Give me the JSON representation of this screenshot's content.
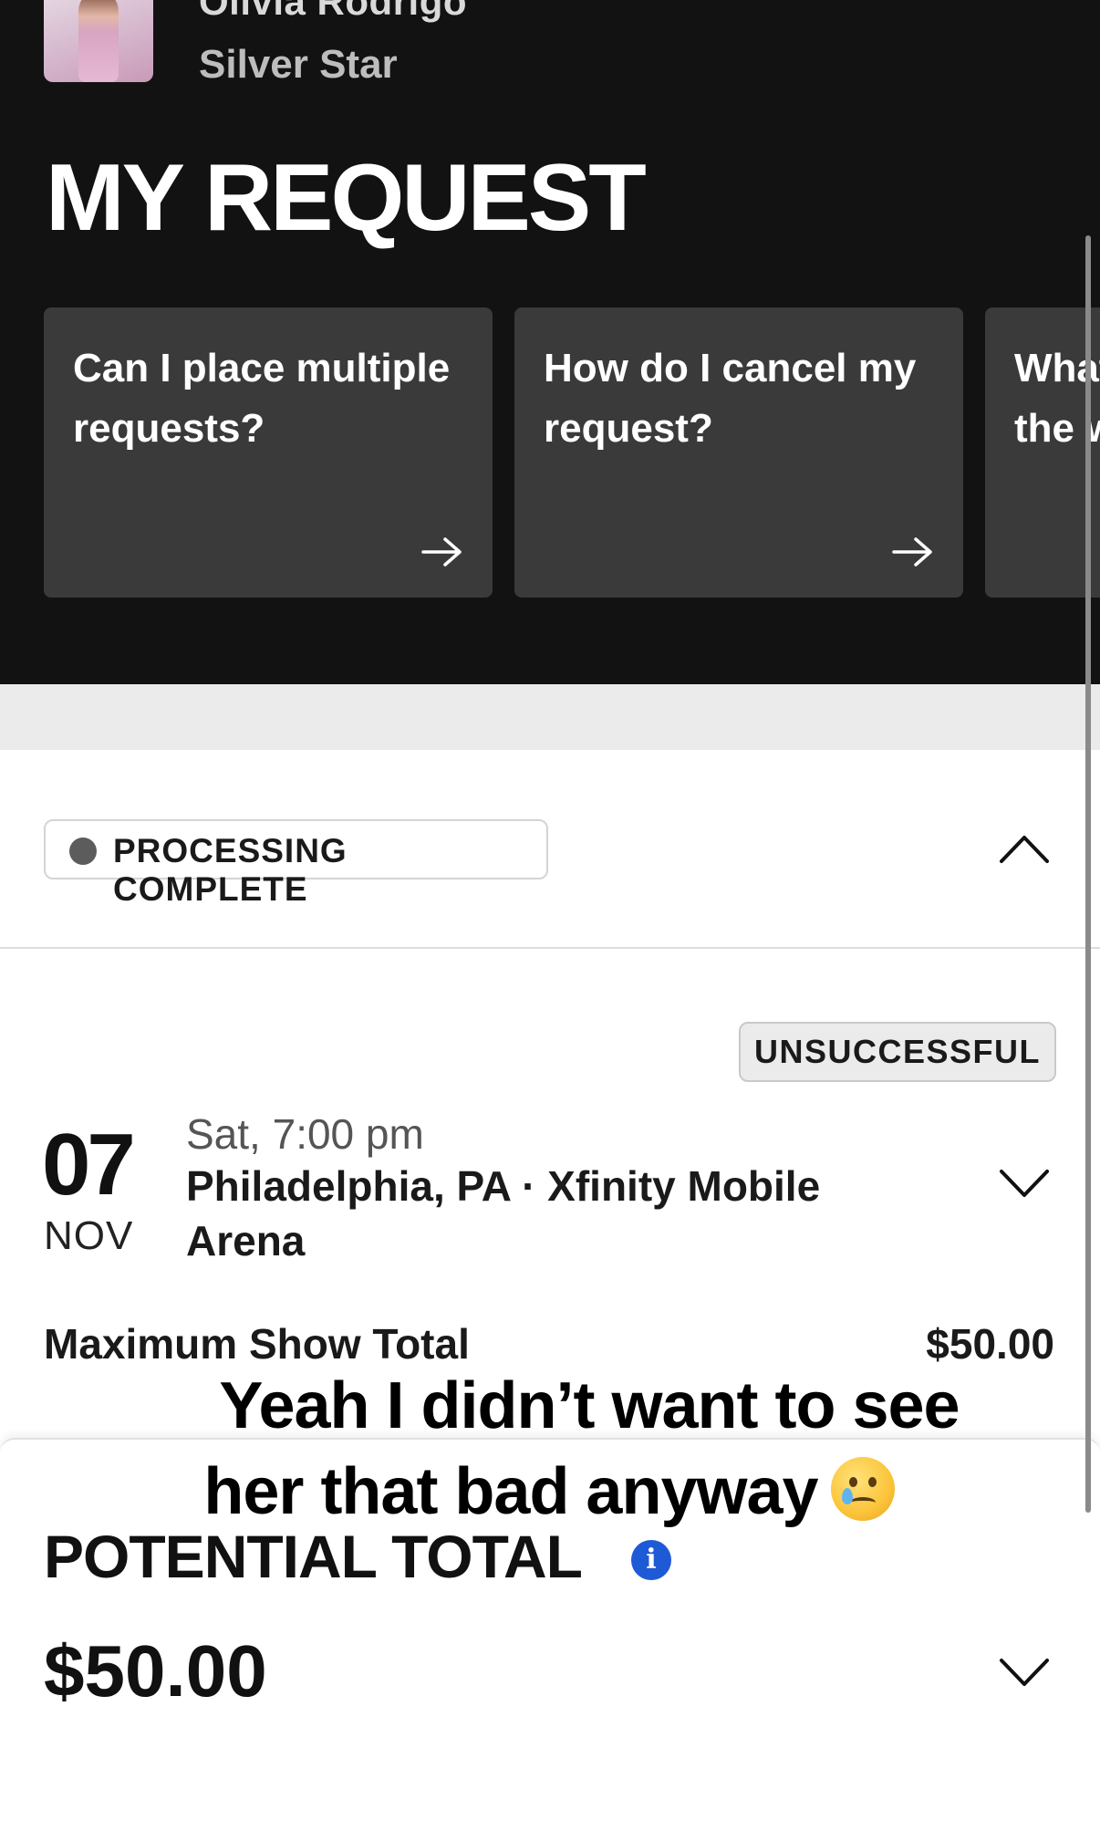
{
  "artist": {
    "name": "Olivia Rodrigo",
    "tier": "Silver Star"
  },
  "page_title": "MY REQUEST",
  "faq_cards": [
    {
      "question": "Can I place multiple requests?"
    },
    {
      "question": "How do I cancel my request?"
    },
    {
      "question": "What happens once the window"
    }
  ],
  "request": {
    "status": "PROCESSING COMPLETE",
    "result": "UNSUCCESSFUL",
    "event": {
      "day": "07",
      "month": "NOV",
      "time": "Sat, 7:00 pm",
      "venue": "Philadelphia, PA · Xfinity Mobile Arena"
    },
    "max_show_total_label": "Maximum Show Total",
    "max_show_total_value": "$50.00"
  },
  "summary": {
    "potential_total_label": "POTENTIAL TOTAL",
    "info_glyph": "i",
    "potential_total_value": "$50.00"
  },
  "caption": {
    "line1": "Yeah I didn’t want to see",
    "line2": "her that bad anyway",
    "emoji_icon": "crying-face-emoji"
  },
  "colors": {
    "header_bg": "#121212",
    "card_bg": "#3a3a3a",
    "info_blue": "#1f5ad6",
    "badge_bg": "#ebebeb"
  }
}
